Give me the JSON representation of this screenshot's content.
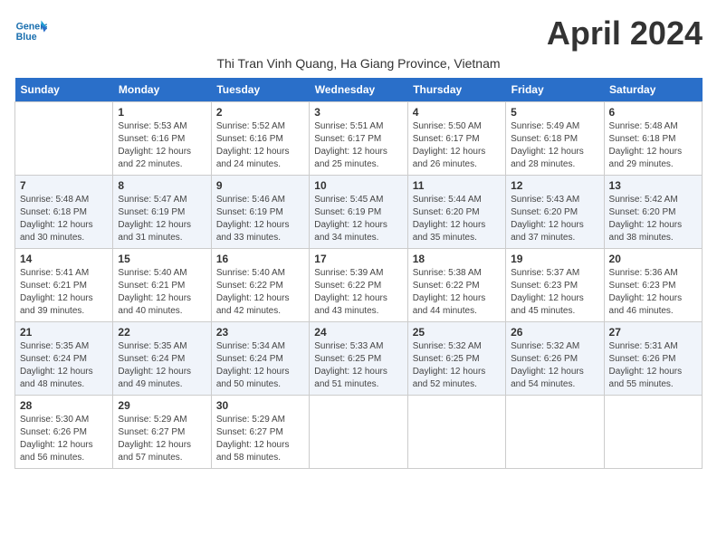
{
  "logo": {
    "line1": "General",
    "line2": "Blue"
  },
  "title": "April 2024",
  "subtitle": "Thi Tran Vinh Quang, Ha Giang Province, Vietnam",
  "days_of_week": [
    "Sunday",
    "Monday",
    "Tuesday",
    "Wednesday",
    "Thursday",
    "Friday",
    "Saturday"
  ],
  "weeks": [
    [
      {
        "day": "",
        "info": ""
      },
      {
        "day": "1",
        "info": "Sunrise: 5:53 AM\nSunset: 6:16 PM\nDaylight: 12 hours\nand 22 minutes."
      },
      {
        "day": "2",
        "info": "Sunrise: 5:52 AM\nSunset: 6:16 PM\nDaylight: 12 hours\nand 24 minutes."
      },
      {
        "day": "3",
        "info": "Sunrise: 5:51 AM\nSunset: 6:17 PM\nDaylight: 12 hours\nand 25 minutes."
      },
      {
        "day": "4",
        "info": "Sunrise: 5:50 AM\nSunset: 6:17 PM\nDaylight: 12 hours\nand 26 minutes."
      },
      {
        "day": "5",
        "info": "Sunrise: 5:49 AM\nSunset: 6:18 PM\nDaylight: 12 hours\nand 28 minutes."
      },
      {
        "day": "6",
        "info": "Sunrise: 5:48 AM\nSunset: 6:18 PM\nDaylight: 12 hours\nand 29 minutes."
      }
    ],
    [
      {
        "day": "7",
        "info": "Sunrise: 5:48 AM\nSunset: 6:18 PM\nDaylight: 12 hours\nand 30 minutes."
      },
      {
        "day": "8",
        "info": "Sunrise: 5:47 AM\nSunset: 6:19 PM\nDaylight: 12 hours\nand 31 minutes."
      },
      {
        "day": "9",
        "info": "Sunrise: 5:46 AM\nSunset: 6:19 PM\nDaylight: 12 hours\nand 33 minutes."
      },
      {
        "day": "10",
        "info": "Sunrise: 5:45 AM\nSunset: 6:19 PM\nDaylight: 12 hours\nand 34 minutes."
      },
      {
        "day": "11",
        "info": "Sunrise: 5:44 AM\nSunset: 6:20 PM\nDaylight: 12 hours\nand 35 minutes."
      },
      {
        "day": "12",
        "info": "Sunrise: 5:43 AM\nSunset: 6:20 PM\nDaylight: 12 hours\nand 37 minutes."
      },
      {
        "day": "13",
        "info": "Sunrise: 5:42 AM\nSunset: 6:20 PM\nDaylight: 12 hours\nand 38 minutes."
      }
    ],
    [
      {
        "day": "14",
        "info": "Sunrise: 5:41 AM\nSunset: 6:21 PM\nDaylight: 12 hours\nand 39 minutes."
      },
      {
        "day": "15",
        "info": "Sunrise: 5:40 AM\nSunset: 6:21 PM\nDaylight: 12 hours\nand 40 minutes."
      },
      {
        "day": "16",
        "info": "Sunrise: 5:40 AM\nSunset: 6:22 PM\nDaylight: 12 hours\nand 42 minutes."
      },
      {
        "day": "17",
        "info": "Sunrise: 5:39 AM\nSunset: 6:22 PM\nDaylight: 12 hours\nand 43 minutes."
      },
      {
        "day": "18",
        "info": "Sunrise: 5:38 AM\nSunset: 6:22 PM\nDaylight: 12 hours\nand 44 minutes."
      },
      {
        "day": "19",
        "info": "Sunrise: 5:37 AM\nSunset: 6:23 PM\nDaylight: 12 hours\nand 45 minutes."
      },
      {
        "day": "20",
        "info": "Sunrise: 5:36 AM\nSunset: 6:23 PM\nDaylight: 12 hours\nand 46 minutes."
      }
    ],
    [
      {
        "day": "21",
        "info": "Sunrise: 5:35 AM\nSunset: 6:24 PM\nDaylight: 12 hours\nand 48 minutes."
      },
      {
        "day": "22",
        "info": "Sunrise: 5:35 AM\nSunset: 6:24 PM\nDaylight: 12 hours\nand 49 minutes."
      },
      {
        "day": "23",
        "info": "Sunrise: 5:34 AM\nSunset: 6:24 PM\nDaylight: 12 hours\nand 50 minutes."
      },
      {
        "day": "24",
        "info": "Sunrise: 5:33 AM\nSunset: 6:25 PM\nDaylight: 12 hours\nand 51 minutes."
      },
      {
        "day": "25",
        "info": "Sunrise: 5:32 AM\nSunset: 6:25 PM\nDaylight: 12 hours\nand 52 minutes."
      },
      {
        "day": "26",
        "info": "Sunrise: 5:32 AM\nSunset: 6:26 PM\nDaylight: 12 hours\nand 54 minutes."
      },
      {
        "day": "27",
        "info": "Sunrise: 5:31 AM\nSunset: 6:26 PM\nDaylight: 12 hours\nand 55 minutes."
      }
    ],
    [
      {
        "day": "28",
        "info": "Sunrise: 5:30 AM\nSunset: 6:26 PM\nDaylight: 12 hours\nand 56 minutes."
      },
      {
        "day": "29",
        "info": "Sunrise: 5:29 AM\nSunset: 6:27 PM\nDaylight: 12 hours\nand 57 minutes."
      },
      {
        "day": "30",
        "info": "Sunrise: 5:29 AM\nSunset: 6:27 PM\nDaylight: 12 hours\nand 58 minutes."
      },
      {
        "day": "",
        "info": ""
      },
      {
        "day": "",
        "info": ""
      },
      {
        "day": "",
        "info": ""
      },
      {
        "day": "",
        "info": ""
      }
    ]
  ]
}
